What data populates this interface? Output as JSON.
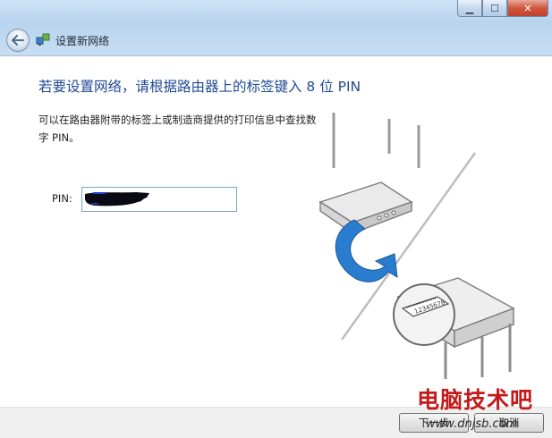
{
  "window": {
    "title": "设置新网络",
    "controls": {
      "minimize": "▁",
      "maximize": "☐",
      "close": "✕"
    }
  },
  "main": {
    "heading": "若要设置网络，请根据路由器上的标签键入 8 位 PIN",
    "description": "可以在路由器附带的标签上或制造商提供的打印信息中查找数字 PIN。",
    "pin_label": "PIN:",
    "pin_value": "",
    "sticker_text": "12345678"
  },
  "footer": {
    "next_label": "下一步",
    "cancel_label": "取消"
  },
  "watermark": {
    "text": "电脑技术吧",
    "url": "www.dnjsb.com"
  },
  "colors": {
    "heading": "#1f4a94",
    "titlebar": "#b9d4ef",
    "arrow": "#2a7ccf",
    "watermark": "#c41a1a"
  },
  "icons": [
    "back-arrow-icon",
    "network-setup-icon",
    "minimize-icon",
    "maximize-icon",
    "close-icon"
  ]
}
